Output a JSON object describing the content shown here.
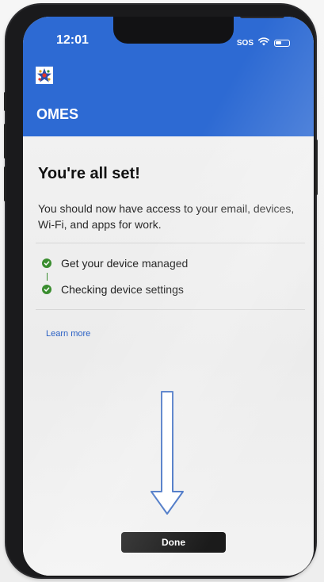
{
  "status_bar": {
    "time": "12:01",
    "carrier": "SOS"
  },
  "header": {
    "app_name": "OMES",
    "logo_icon": "star-logo-icon",
    "background_color": "#2d6ad3"
  },
  "content": {
    "heading": "You're all set!",
    "description": "You should now have access to your email, devices, Wi-Fi, and apps for work.",
    "steps": [
      {
        "label": "Get your device managed",
        "status": "complete"
      },
      {
        "label": "Checking device settings",
        "status": "complete"
      }
    ],
    "learn_more_link": "Learn more"
  },
  "footer": {
    "done_button": "Done"
  },
  "colors": {
    "accent": "#2d6ad3",
    "success": "#3a8d2f",
    "link": "#2a60c4",
    "button": "#1b1b1b"
  },
  "annotation": {
    "arrow_icon": "down-arrow-icon",
    "arrow_color": "#4472c4"
  }
}
